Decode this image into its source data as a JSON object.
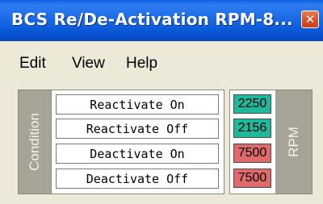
{
  "window": {
    "title": "BCS Re/De-Activation RPM-8...",
    "close_glyph": "✕",
    "close_icon": "close-icon"
  },
  "menu": {
    "items": [
      "Edit",
      "View",
      "Help"
    ]
  },
  "condition_panel": {
    "header": "Condition",
    "rows": [
      "Reactivate On",
      "Reactivate Off",
      "Deactivate On",
      "Deactivate Off"
    ]
  },
  "rpm_panel": {
    "header": "RPM",
    "values": [
      {
        "value": "2250",
        "status_color": "#20b89a"
      },
      {
        "value": "2156",
        "status_color": "#20b89a"
      },
      {
        "value": "7500",
        "status_color": "#e06a6a"
      },
      {
        "value": "7500",
        "status_color": "#e06a6a"
      }
    ]
  },
  "colors": {
    "title_bar": "#0a58d6",
    "window_bg": "#ece9d8",
    "header_bg": "#a6a496",
    "ok": "#20b89a",
    "alert": "#e06a6a"
  }
}
